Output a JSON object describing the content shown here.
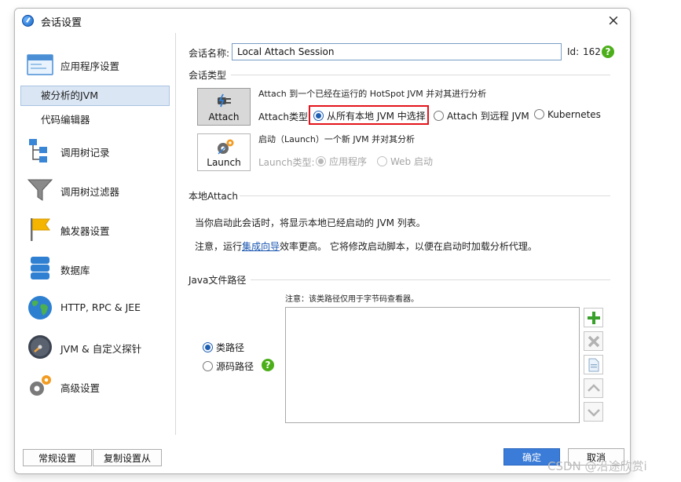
{
  "window": {
    "title": "会话设置",
    "close": "×"
  },
  "nav": {
    "items": [
      {
        "label": "应用程序设置",
        "icon": "window-icon"
      },
      {
        "label": "被分析的JVM",
        "sub": true,
        "selected": true
      },
      {
        "label": "代码编辑器",
        "sub": true
      },
      {
        "label": "调用树记录",
        "icon": "call-tree-icon"
      },
      {
        "label": "调用树过滤器",
        "icon": "funnel-icon"
      },
      {
        "label": "触发器设置",
        "icon": "flag-icon"
      },
      {
        "label": "数据库",
        "icon": "database-icon"
      },
      {
        "label": "HTTP, RPC & JEE",
        "icon": "globe-icon"
      },
      {
        "label": "JVM & 自定义探针",
        "icon": "gauge-icon"
      },
      {
        "label": "高级设置",
        "icon": "gears-icon"
      }
    ]
  },
  "session": {
    "name_label": "会话名称:",
    "name_value": "Local Attach Session",
    "id_label": "Id:",
    "id_value": "162",
    "help": "?"
  },
  "session_type": {
    "section_title": "会话类型",
    "attach_button": "Attach",
    "attach_desc": "Attach 到一个已经在运行的 HotSpot JVM 并对其进行分析",
    "attach_type_label": "Attach类型:",
    "attach_options": [
      {
        "label": "从所有本地 JVM 中选择",
        "checked": true
      },
      {
        "label": "Attach 到远程 JVM",
        "checked": false
      },
      {
        "label": "Kubernetes",
        "checked": false
      }
    ],
    "launch_button": "Launch",
    "launch_desc": "启动（Launch）一个新 JVM 并对其分析",
    "launch_type_label": "Launch类型:",
    "launch_options": [
      {
        "label": "应用程序",
        "checked": true
      },
      {
        "label": "Web 启动",
        "checked": false
      }
    ]
  },
  "local_attach": {
    "section_title": "本地Attach",
    "line1": "当你启动此会话时，将显示本地已经启动的 JVM 列表。",
    "line2_before": "注意，运行",
    "line2_link": "集成向导",
    "line2_after": "效率更高。 它将修改启动脚本，以便在启动时加载分析代理。"
  },
  "java_path": {
    "section_title": "Java文件路径",
    "note": "注意：该类路径仅用于字节码查看器。",
    "options": [
      {
        "label": "类路径",
        "checked": true
      },
      {
        "label": "源码路径",
        "checked": false
      }
    ],
    "help": "?"
  },
  "footer": {
    "general": "常规设置",
    "copy": "复制设置从",
    "ok": "确定",
    "cancel": "取消"
  },
  "watermark": "CSDN @沿途欣赏i",
  "colors": {
    "highlight": "#e3141b",
    "primary": "#3b7cd8",
    "selection": "#dbe6f4"
  }
}
